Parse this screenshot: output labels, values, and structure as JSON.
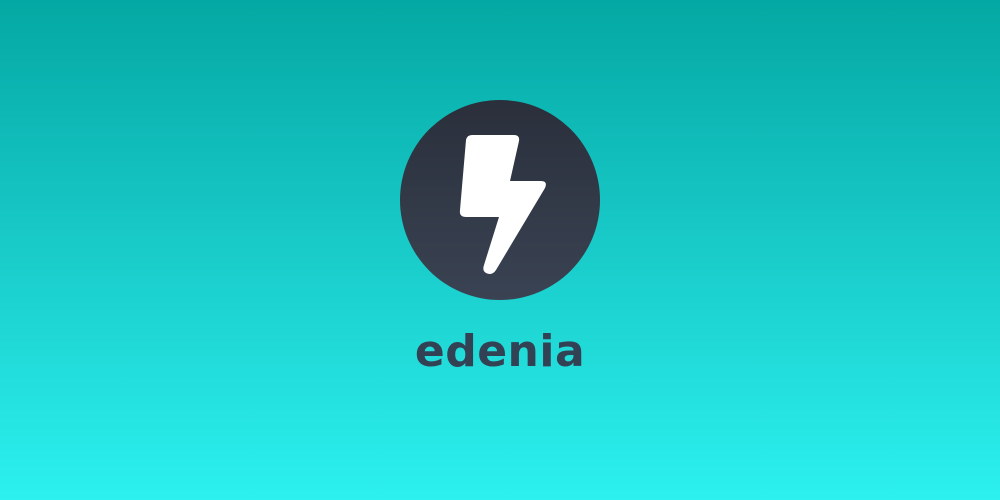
{
  "brand": {
    "name": "edenia",
    "logo_icon": "lightning-bolt-icon"
  },
  "colors": {
    "background_top": "#04a8a3",
    "background_bottom": "#2cf1ef",
    "circle_top": "#2a2f3b",
    "circle_bottom": "#3a4353",
    "bolt": "#ffffff",
    "brand_text": "#334155"
  }
}
